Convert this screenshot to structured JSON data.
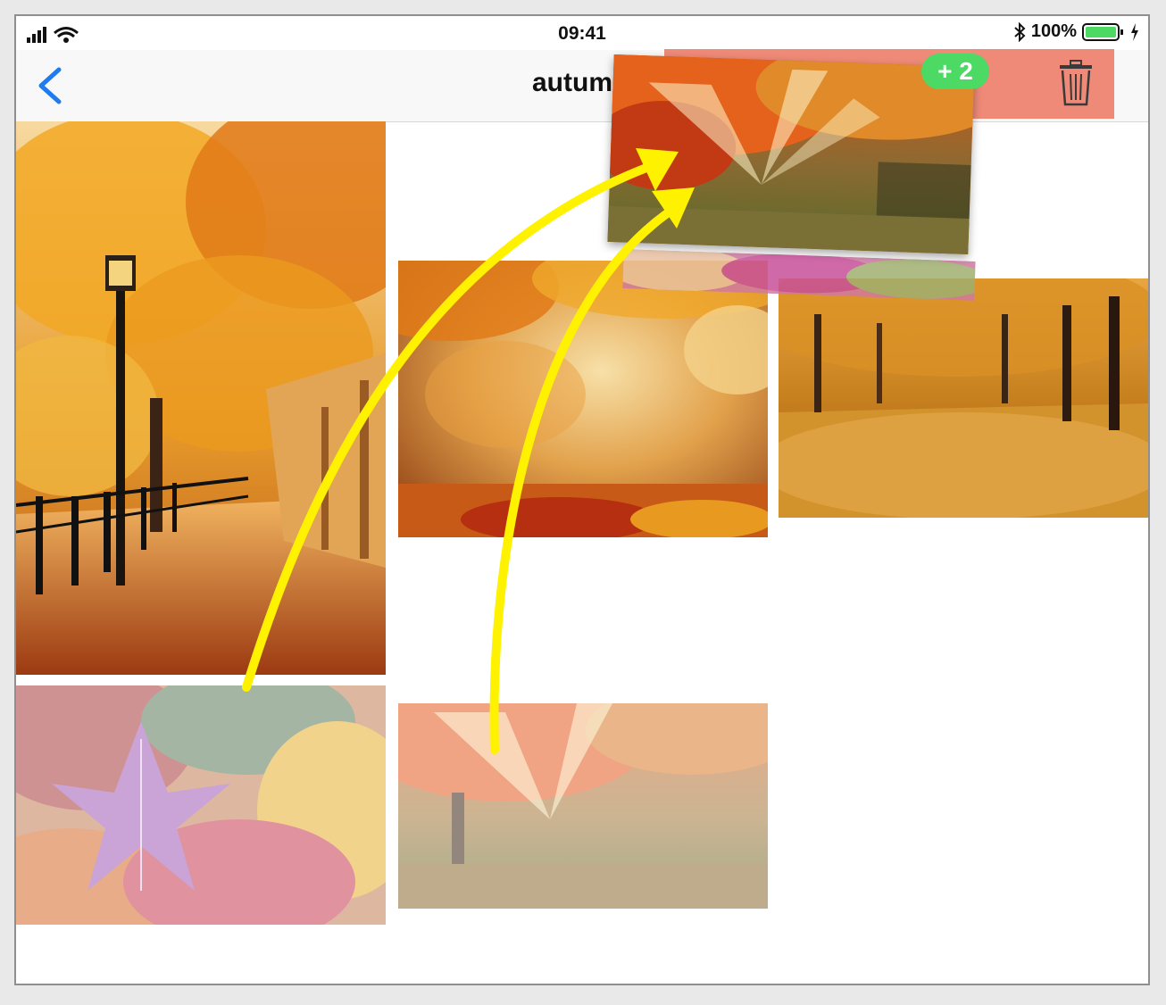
{
  "status_bar": {
    "time": "09:41",
    "battery_percent": "100%",
    "icons": [
      "signal-bars-icon",
      "wifi-icon",
      "bluetooth-icon",
      "battery-icon",
      "charging-bolt-icon"
    ]
  },
  "nav": {
    "back_icon": "chevron-left-icon",
    "title": "autum",
    "delete_icon": "trash-icon"
  },
  "drag": {
    "count_badge": "+ 2",
    "drop_zone_color": "#ef8a78",
    "badge_color": "#4cd964"
  },
  "photos": [
    {
      "name": "autumn-park-lamppost"
    },
    {
      "name": "autumn-leaves-blur"
    },
    {
      "name": "autumn-avenue"
    },
    {
      "name": "maple-leaves-pile"
    },
    {
      "name": "sunrays-through-leaves"
    }
  ],
  "colors": {
    "accent_blue": "#1e7cf0",
    "arrow_yellow": "#fff200"
  }
}
